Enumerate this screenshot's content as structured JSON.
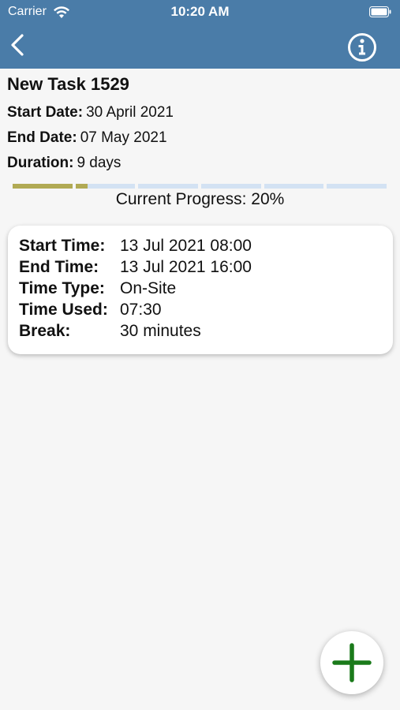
{
  "status_bar": {
    "carrier": "Carrier",
    "time": "10:20 AM"
  },
  "nav": {
    "back_icon": "chevron-left-icon",
    "info_icon": "info-circle-icon"
  },
  "task": {
    "title": "New Task 1529",
    "start_date_label": "Start Date:",
    "start_date": "30 April 2021",
    "end_date_label": "End Date:",
    "end_date": "07 May 2021",
    "duration_label": "Duration:",
    "duration": "9 days"
  },
  "progress": {
    "value_percent": 20,
    "segments_total": 6,
    "label": "Current Progress: 20%",
    "filled_color": "#b1aa54",
    "empty_color": "#d3e2f3"
  },
  "time_entry": {
    "start_time_label": "Start Time:",
    "start_time": "13 Jul 2021 08:00",
    "end_time_label": "End Time:",
    "end_time": "13 Jul 2021 16:00",
    "time_type_label": "Time Type:",
    "time_type": "On-Site",
    "time_used_label": "Time Used:",
    "time_used": "07:30",
    "break_label": "Break:",
    "break": "30 minutes"
  },
  "fab": {
    "icon": "plus-icon",
    "color": "#1a7a1a"
  },
  "colors": {
    "header": "#4a7ca8",
    "background": "#f6f6f6"
  }
}
